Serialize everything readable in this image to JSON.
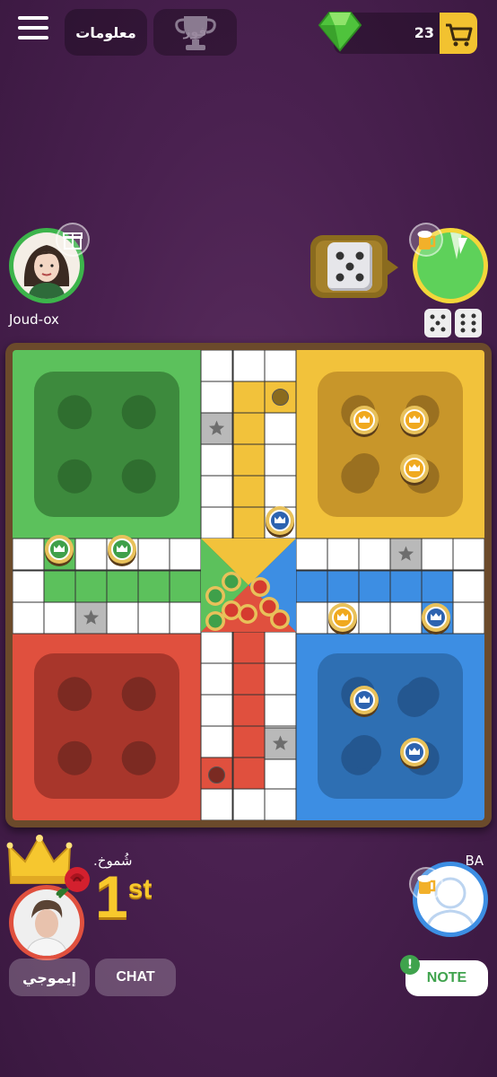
{
  "topbar": {
    "info_label": "معلومات",
    "win_label": "فوز",
    "gem_count": "23",
    "menu_icon": "hamburger-menu-icon",
    "cart_icon": "shopping-cart-icon",
    "gem_icon": "green-gem-icon",
    "trophy_icon": "trophy-icon"
  },
  "players": {
    "top_left": {
      "name": "Joud-ox",
      "color": "#3cb44b"
    },
    "top_right": {
      "name": "",
      "color": "#5ed15a"
    },
    "bottom_left": {
      "name": "شُموخ.",
      "rank": "1",
      "rank_suffix": "st"
    },
    "bottom_right": {
      "name": "BA"
    }
  },
  "colors": {
    "green": "#5cc15c",
    "yellow": "#f2c23b",
    "red": "#e0503e",
    "blue": "#3d8ee3",
    "board_frame": "#6b4a2b",
    "background": "#4a2150"
  },
  "buttons": {
    "emoji_label": "إيموجي",
    "chat_label": "CHAT",
    "note_label": "NOTE"
  },
  "note_badge": "!"
}
